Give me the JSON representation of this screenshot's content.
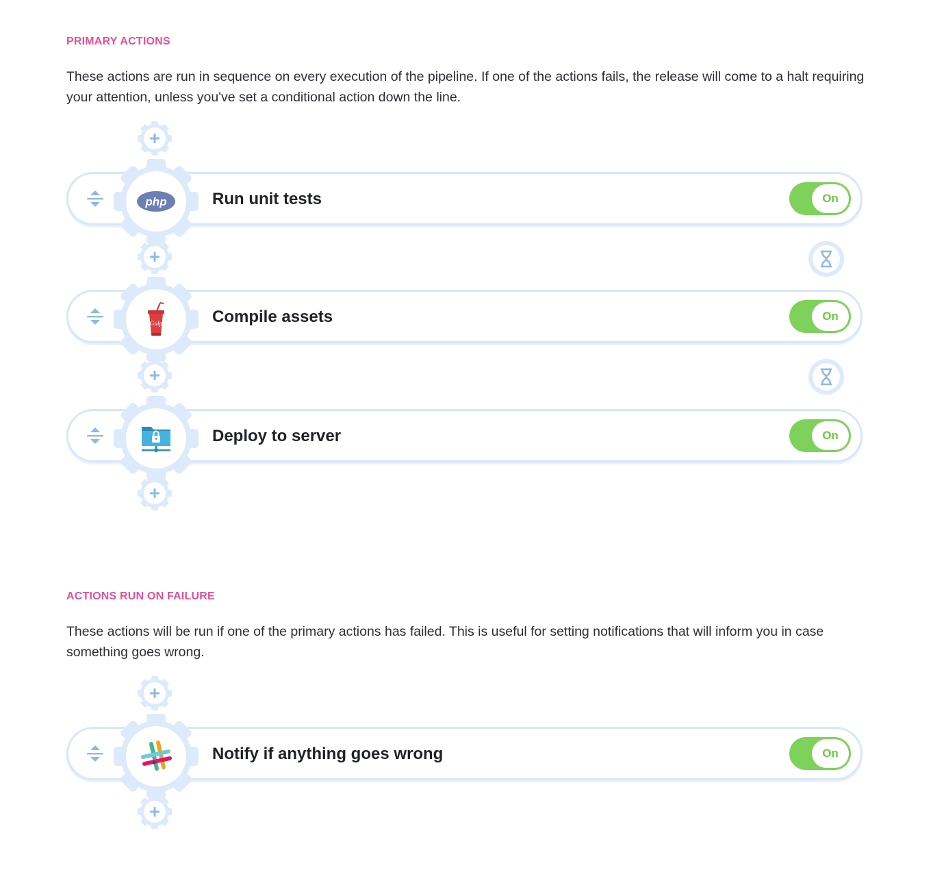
{
  "primary": {
    "title": "PRIMARY ACTIONS",
    "description": "These actions are run in sequence on every execution of the pipeline. If one of the actions fails, the release will come to a halt requiring your attention, unless you've set a conditional action down the line.",
    "actions": [
      {
        "label": "Run unit tests",
        "icon": "php-icon",
        "toggle": "On"
      },
      {
        "label": "Compile assets",
        "icon": "gulp-icon",
        "toggle": "On"
      },
      {
        "label": "Deploy to server",
        "icon": "sftp-server-icon",
        "toggle": "On"
      }
    ]
  },
  "failure": {
    "title": "ACTIONS RUN ON FAILURE",
    "description": "These actions will be run if one of the primary actions has failed. This is useful for setting notifications that will inform you in case something goes wrong.",
    "actions": [
      {
        "label": "Notify if anything goes wrong",
        "icon": "slack-icon",
        "toggle": "On"
      }
    ]
  },
  "icons": {
    "add": "plus-icon",
    "drag": "drag-handle-icon",
    "wait": "hourglass-icon"
  },
  "colors": {
    "section_title": "#e0519a",
    "toggle_on": "#7ed25b",
    "row_border": "#d7e7fb",
    "accent_blue": "#8fb7ea"
  }
}
